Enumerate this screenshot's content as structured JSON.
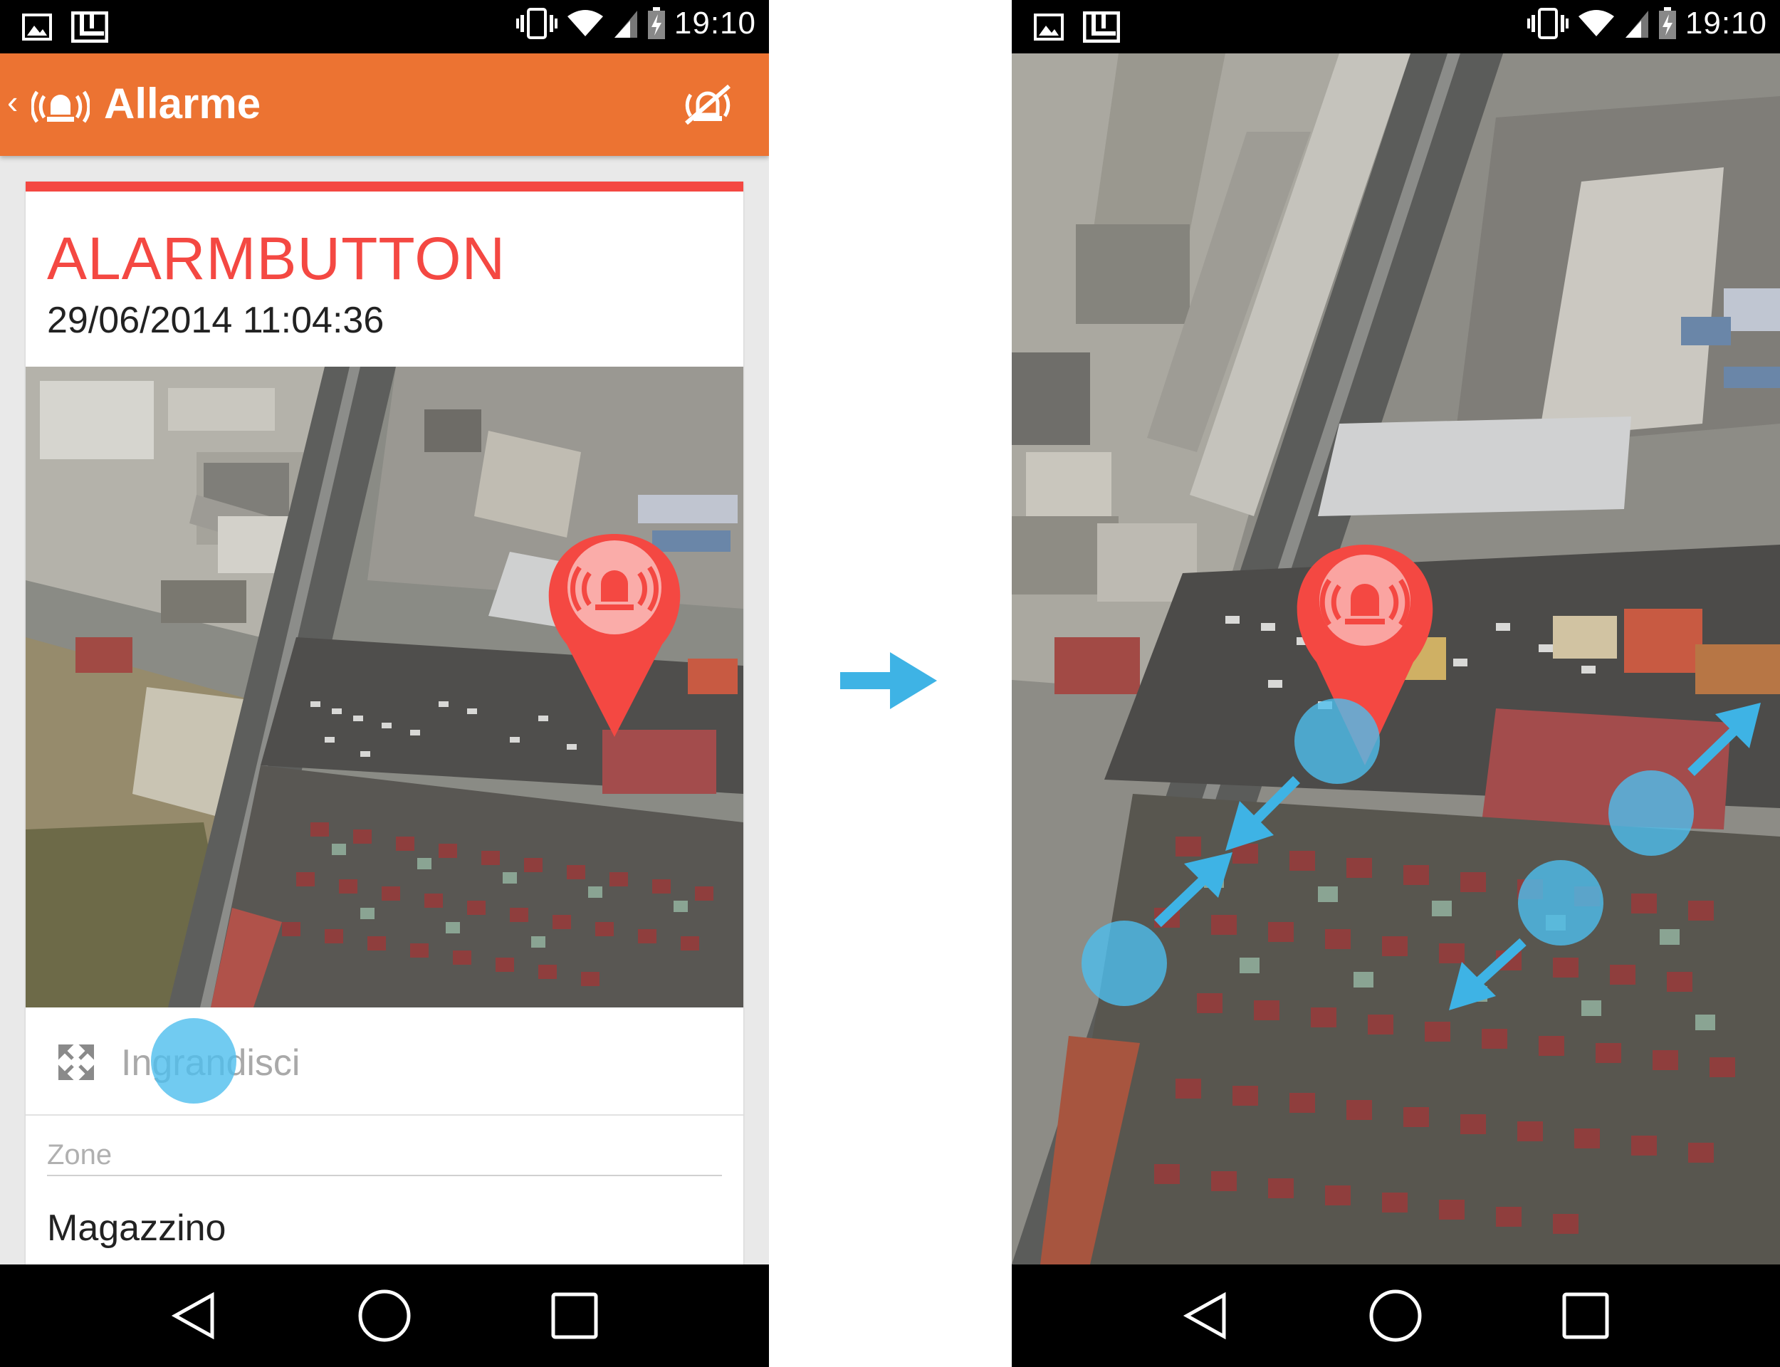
{
  "status_bar": {
    "time": "19:10"
  },
  "app_bar": {
    "title": "Allarme",
    "back_icon": "chevron-left-icon",
    "logo_icon": "alarm-siren-icon",
    "action_icon": "alarm-off-icon"
  },
  "alarm": {
    "title": "ALARMBUTTON",
    "datetime": "29/06/2014 11:04:36",
    "stripe_color": "#f44842"
  },
  "map": {
    "marker_icon": "alarm-siren-icon",
    "marker_color": "#f44842"
  },
  "enlarge": {
    "label": "Ingrandisci",
    "icon": "expand-arrows-icon"
  },
  "zone": {
    "label": "Zone",
    "value": "Magazzino"
  },
  "nav_bar": {
    "back_icon": "triangle-back-icon",
    "home_icon": "circle-home-icon",
    "recents_icon": "square-recents-icon"
  },
  "gesture": {
    "color": "#3eb3e5",
    "description_icon": "pinch-zoom-gesture-icon"
  },
  "colors": {
    "app_bar": "#ec7332",
    "accent_red": "#f44842",
    "touch": "#4dbeee"
  }
}
